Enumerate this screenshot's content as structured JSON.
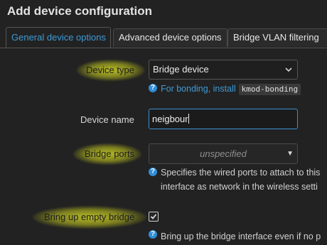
{
  "dialog": {
    "title": "Add device configuration"
  },
  "tabs": [
    {
      "label": "General device options",
      "active": true
    },
    {
      "label": "Advanced device options",
      "active": false
    },
    {
      "label": "Bridge VLAN filtering",
      "active": false
    }
  ],
  "fields": {
    "device_type": {
      "label": "Device type",
      "value": "Bridge device",
      "help_link": "For bonding, install",
      "help_code": "kmod-bonding"
    },
    "device_name": {
      "label": "Device name",
      "value": "neigbour"
    },
    "bridge_ports": {
      "label": "Bridge ports",
      "placeholder": "unspecified",
      "help_line1": "Specifies the wired ports to attach to this",
      "help_line2": "interface as network in the wireless setti"
    },
    "bring_up_empty": {
      "label": "Bring up empty bridge",
      "checked": true,
      "help": "Bring up the bridge interface even if no p"
    }
  },
  "colors": {
    "accent": "#3d9bd8",
    "highlight": "#e8ec2a",
    "background": "#222222"
  }
}
